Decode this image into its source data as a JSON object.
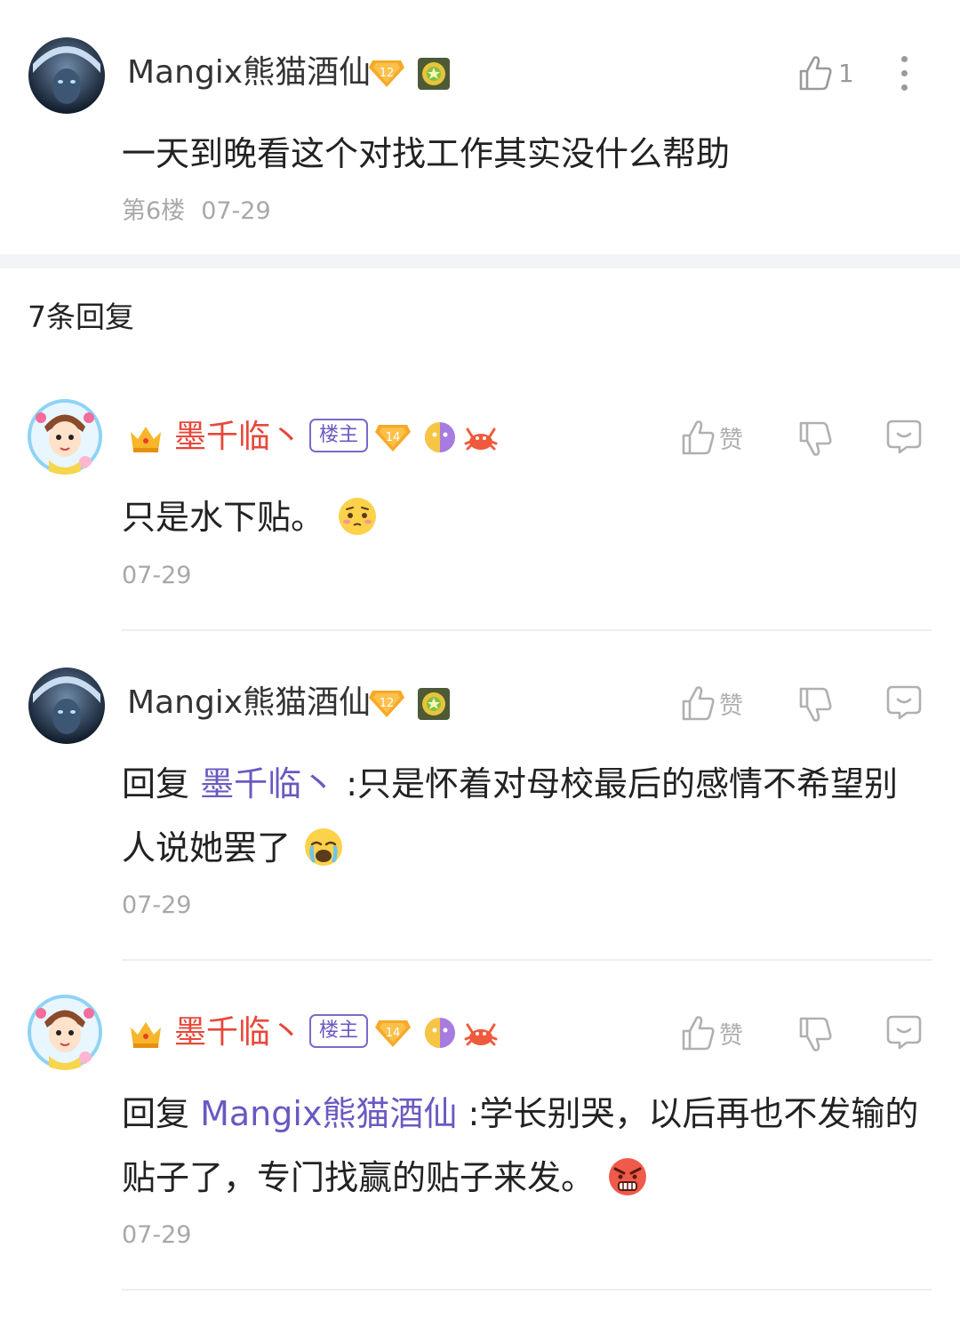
{
  "post": {
    "author": "Mangix熊猫酒仙",
    "level": "12",
    "like_count": "1",
    "content": "一天到晚看这个对找工作其实没什么帮助",
    "floor": "第6楼",
    "date": "07-29"
  },
  "replies_header": "7条回复",
  "replies": [
    {
      "author": "墨千临丶",
      "op_tag": "楼主",
      "level": "14",
      "like_label": "赞",
      "text": "只是水下贴。",
      "date": "07-29"
    },
    {
      "author": "Mangix熊猫酒仙",
      "level": "12",
      "like_label": "赞",
      "reply_prefix": "回复",
      "mention": "墨千临丶",
      "text": ":只是怀着对母校最后的感情不希望别人说她罢了",
      "date": "07-29"
    },
    {
      "author": "墨千临丶",
      "op_tag": "楼主",
      "level": "14",
      "like_label": "赞",
      "reply_prefix": "回复",
      "mention": "Mangix熊猫酒仙",
      "text": ":学长别哭，以后再也不发输的贴子了，专门找赢的贴子来发。",
      "date": "07-29"
    }
  ],
  "icons": [
    "thumbs-up-icon",
    "thumbs-down-icon",
    "comment-icon",
    "more-icon",
    "crown-icon",
    "level-badge-icon"
  ],
  "colors": {
    "mention": "#6b58c2",
    "op_name": "#e8473a",
    "level_badge": "#f5a623"
  }
}
